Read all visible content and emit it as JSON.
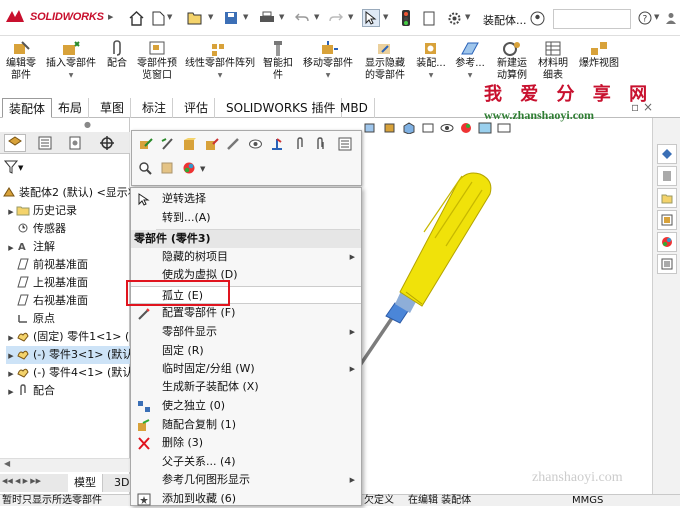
{
  "app": {
    "logo_text": "SOLIDWORKS",
    "document_title": "装配体..."
  },
  "commands": [
    {
      "label_line1": "编辑零",
      "label_line2": "部件"
    },
    {
      "label_line1": "插入零部件",
      "label_line2": ""
    },
    {
      "label_line1": "配合",
      "label_line2": ""
    },
    {
      "label_line1": "零部件预",
      "label_line2": "览窗口"
    },
    {
      "label_line1": "线性零部件阵列",
      "label_line2": ""
    },
    {
      "label_line1": "智能扣",
      "label_line2": "件"
    },
    {
      "label_line1": "移动零部件",
      "label_line2": ""
    },
    {
      "label_line1": "显示隐藏",
      "label_line2": "的零部件"
    },
    {
      "label_line1": "装配...",
      "label_line2": ""
    },
    {
      "label_line1": "参考...",
      "label_line2": ""
    },
    {
      "label_line1": "新建运",
      "label_line2": "动算例"
    },
    {
      "label_line1": "材料明",
      "label_line2": "细表"
    },
    {
      "label_line1": "爆炸视图",
      "label_line2": ""
    }
  ],
  "tabs": [
    "装配体",
    "布局",
    "草图",
    "标注",
    "评估",
    "SOLIDWORKS 插件",
    "MBD"
  ],
  "tree": {
    "root": "装配体2 (默认) <显示状",
    "items": [
      "历史记录",
      "传感器",
      "注解",
      "前视基准面",
      "上视基准面",
      "右视基准面",
      "原点",
      "(固定) 零件1<1> (",
      "(-) 零件3<1> (默认",
      "(-) 零件4<1> (默认",
      "配合"
    ]
  },
  "bottom_tabs": [
    "模型",
    "3D"
  ],
  "context_menu": {
    "items": [
      {
        "label": "逆转选择"
      },
      {
        "label": "转到...(A)"
      },
      {
        "label": "零部件 (零件3)",
        "header": true
      },
      {
        "label": "隐藏的树项目",
        "submenu": true
      },
      {
        "label": "使成为虚拟 (D)"
      },
      {
        "label": "孤立 (E)"
      },
      {
        "label": "配置零部件 (F)"
      },
      {
        "label": "零部件显示",
        "submenu": true
      },
      {
        "label": "固定 (R)"
      },
      {
        "label": "临时固定/分组 (W)",
        "submenu": true
      },
      {
        "label": "生成新子装配体 (X)"
      },
      {
        "label": "使之独立 (0)"
      },
      {
        "label": "随配合复制 (1)"
      },
      {
        "label": "删除 (3)"
      },
      {
        "label": "父子关系... (4)"
      },
      {
        "label": "参考几何图形显示",
        "submenu": true
      },
      {
        "label": "添加到收藏 (6)"
      }
    ]
  },
  "watermark": {
    "title": "我 爱 分 享 网",
    "url": "www.zhanshaoyi.com",
    "footer_url": "zhanshaoyi.com"
  },
  "status": {
    "left": "暂时只显示所选零部件",
    "mid1": "欠定义",
    "mid2": "在编辑 装配体",
    "units": "MMGS"
  },
  "colors": {
    "accent": "#c8102e",
    "handle": "#f0e20a",
    "highlight": "#e0141e",
    "selection": "#cde3f7"
  }
}
